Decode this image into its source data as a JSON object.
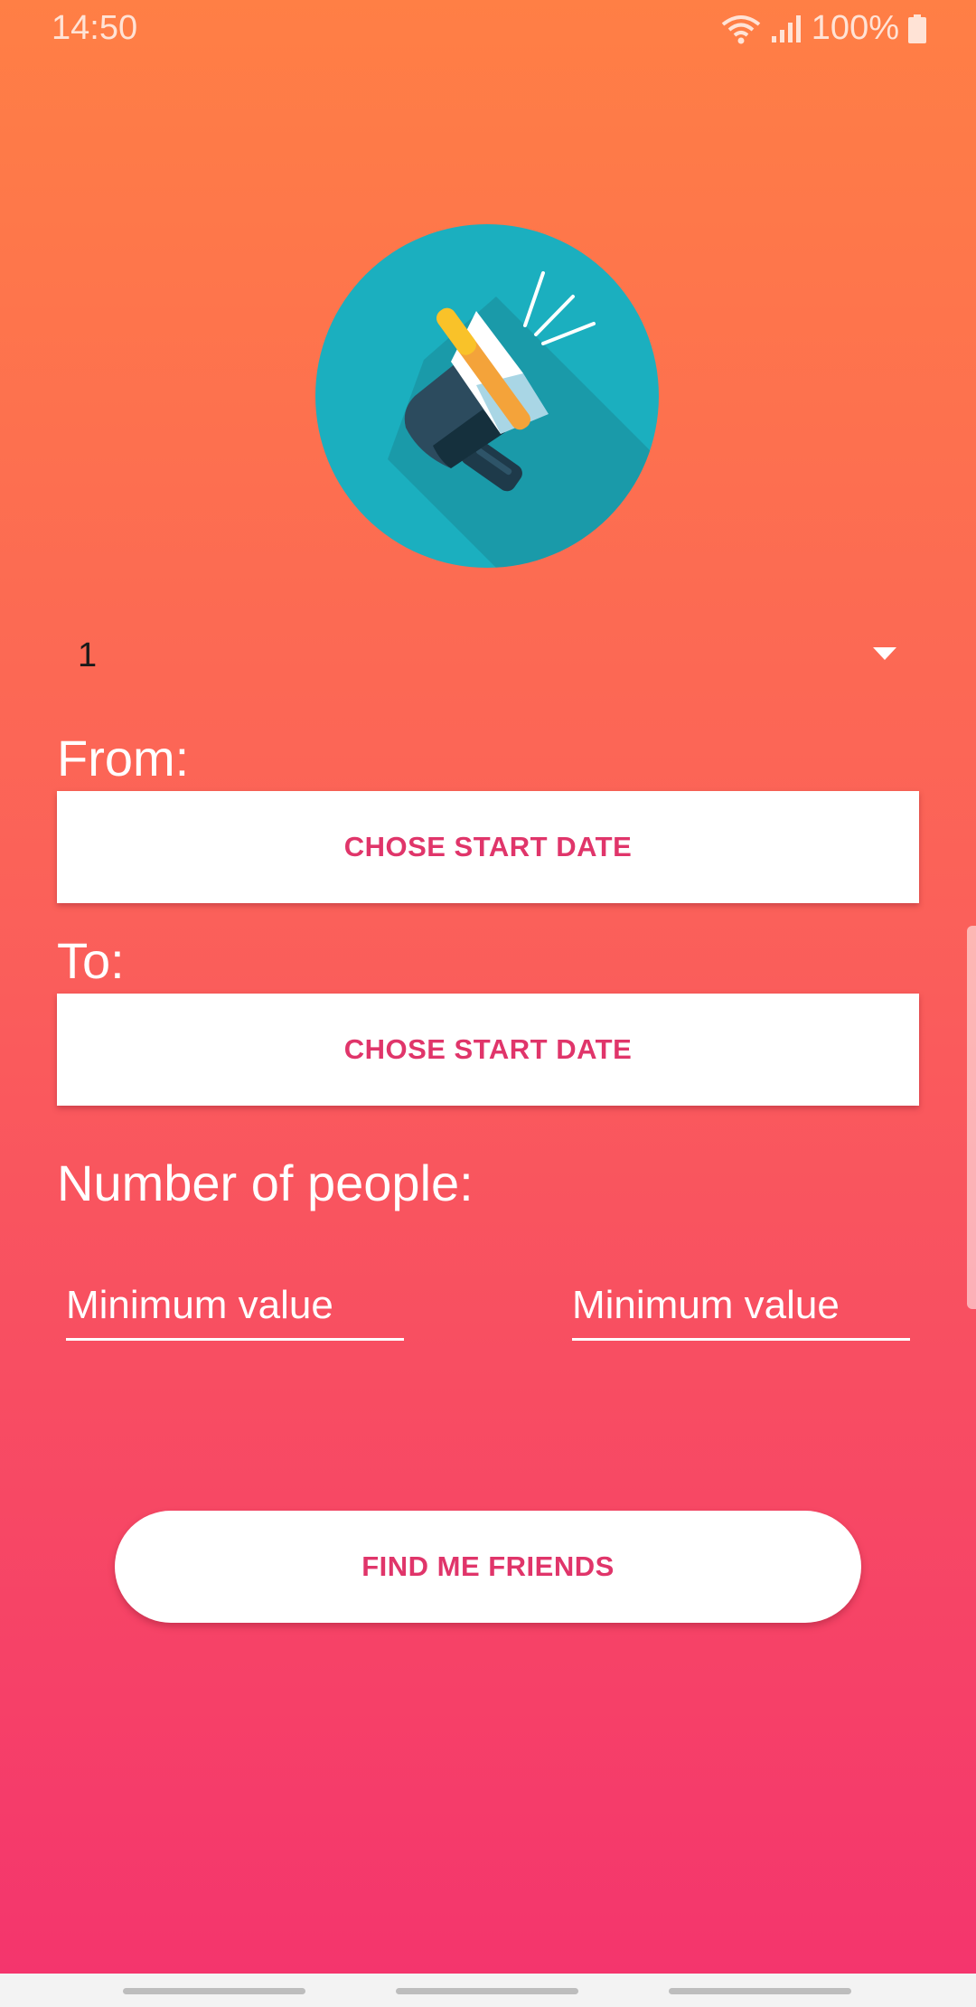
{
  "status_bar": {
    "time": "14:50",
    "battery": "100%",
    "icons": [
      "wifi-icon",
      "signal-icon",
      "battery-icon"
    ]
  },
  "logo": {
    "icon": "megaphone-icon"
  },
  "spinner": {
    "value": "1"
  },
  "from": {
    "label": "From:",
    "button_label": "CHOSE START DATE"
  },
  "to": {
    "label": "To:",
    "button_label": "CHOSE START DATE"
  },
  "people": {
    "label": "Number of people:",
    "min_placeholder": "Minimum value",
    "max_placeholder": "Minimum value"
  },
  "find_button": {
    "label": "FIND ME FRIENDS"
  },
  "colors": {
    "gradient_top": "#FF7F45",
    "gradient_bottom": "#F4356D",
    "accent_text": "#E0356A",
    "logo_bg": "#1BAFBF"
  }
}
